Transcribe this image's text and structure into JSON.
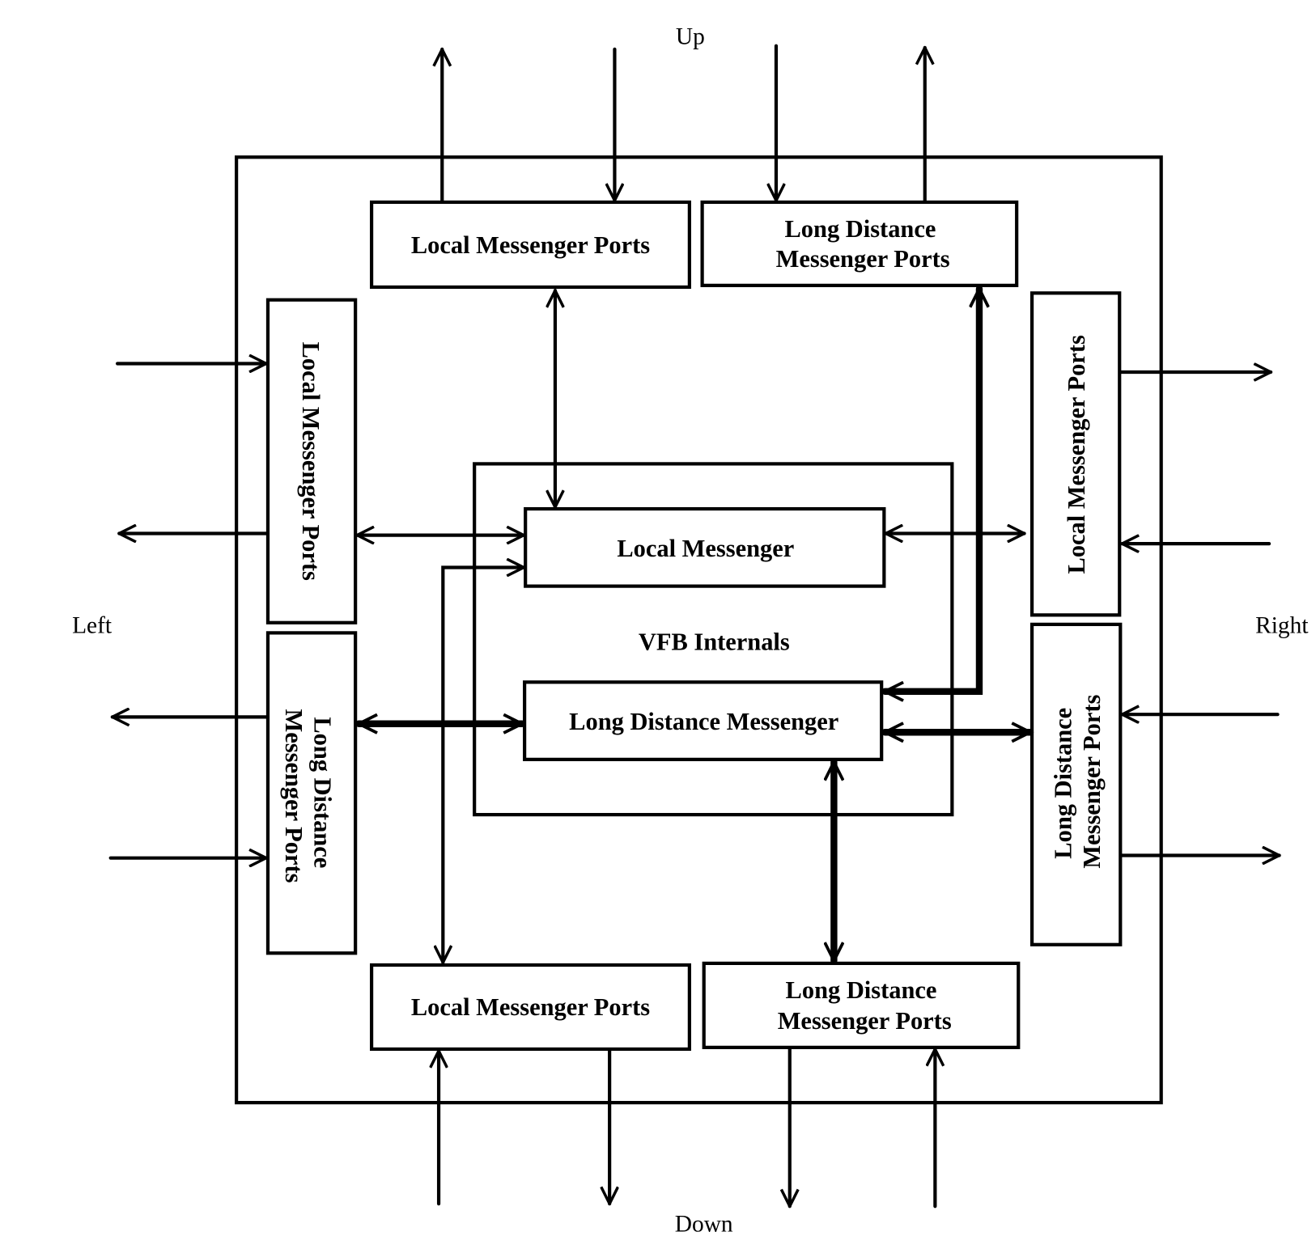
{
  "diagram": {
    "directions": {
      "up": "Up",
      "down": "Down",
      "left": "Left",
      "right": "Right"
    },
    "internals_label": "VFB Internals",
    "core": {
      "local_messenger": "Local Messenger",
      "long_distance_messenger": "Long Distance Messenger"
    },
    "ports": {
      "top_local": "Local Messenger Ports",
      "top_long_line1": "Long Distance",
      "top_long_line2": "Messenger Ports",
      "left_local": "Local Messenger Ports",
      "left_long_line1": "Long Distance",
      "left_long_line2": "Messenger Ports",
      "right_local": "Local Messenger Ports",
      "right_long_line1": "Long Distance",
      "right_long_line2": "Messenger Ports",
      "bottom_local": "Local Messenger Ports",
      "bottom_long_line1": "Long Distance",
      "bottom_long_line2": "Messenger Ports"
    },
    "line_color": "#000000",
    "background": "#ffffff"
  }
}
